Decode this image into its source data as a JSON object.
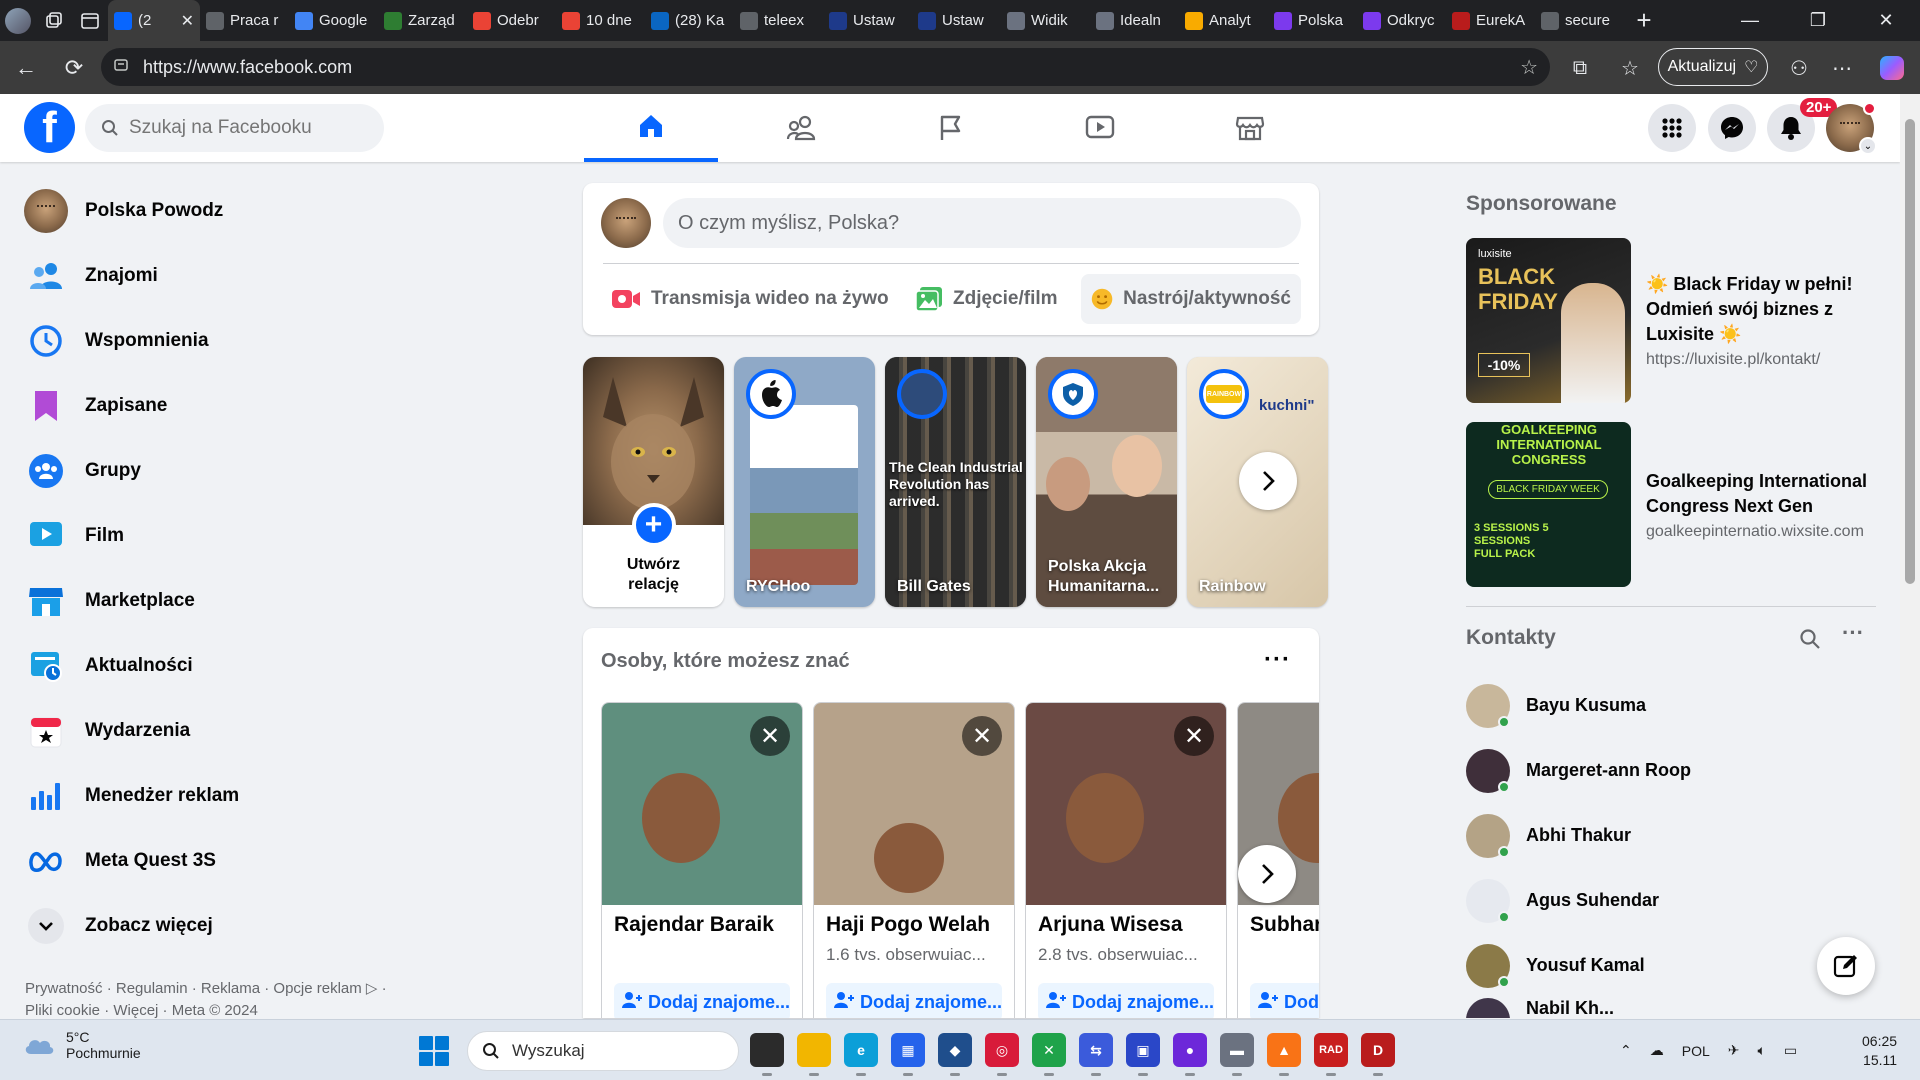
{
  "browser": {
    "tabs": [
      {
        "label": "(2",
        "icon": "facebook-icon",
        "color": "#0866ff",
        "active": true
      },
      {
        "label": "Praca r",
        "icon": "globe-icon",
        "color": "#5f6368"
      },
      {
        "label": "Google",
        "icon": "google-icon",
        "color": "#4285f4"
      },
      {
        "label": "Zarząd",
        "icon": "leaf-icon",
        "color": "#2e7d32"
      },
      {
        "label": "Odebr",
        "icon": "gmail-icon",
        "color": "#ea4335"
      },
      {
        "label": "10 dne",
        "icon": "gmail-icon",
        "color": "#ea4335"
      },
      {
        "label": "(28) Ka",
        "icon": "linkedin-icon",
        "color": "#0a66c2"
      },
      {
        "label": "teleex",
        "icon": "search-icon",
        "color": "#5f6368"
      },
      {
        "label": "Ustaw",
        "icon": "eli-icon",
        "color": "#1e3a8a"
      },
      {
        "label": "Ustaw",
        "icon": "eli-icon",
        "color": "#1e3a8a"
      },
      {
        "label": "Widik",
        "icon": "w-icon",
        "color": "#6b7280"
      },
      {
        "label": "Idealn",
        "icon": "wolf-icon",
        "color": "#6b7280"
      },
      {
        "label": "Analyt",
        "icon": "analytics-icon",
        "color": "#f9ab00"
      },
      {
        "label": "Polska",
        "icon": "butterfly-icon",
        "color": "#7c3aed"
      },
      {
        "label": "Odkryc",
        "icon": "butterfly-icon",
        "color": "#7c3aed"
      },
      {
        "label": "EurekA",
        "icon": "eureka-icon",
        "color": "#b91c1c"
      },
      {
        "label": "secure",
        "icon": "search-icon",
        "color": "#5f6368"
      }
    ],
    "url": "https://www.facebook.com",
    "update_label": "Aktualizuj"
  },
  "header": {
    "search_placeholder": "Szukaj na Facebooku",
    "notification_count": "20+"
  },
  "left_nav": [
    {
      "label": "Polska Powodz",
      "icon": "profile-avatar"
    },
    {
      "label": "Znajomi",
      "icon": "friends-icon"
    },
    {
      "label": "Wspomnienia",
      "icon": "memories-icon"
    },
    {
      "label": "Zapisane",
      "icon": "saved-icon"
    },
    {
      "label": "Grupy",
      "icon": "groups-icon"
    },
    {
      "label": "Film",
      "icon": "video-icon"
    },
    {
      "label": "Marketplace",
      "icon": "marketplace-icon"
    },
    {
      "label": "Aktualności",
      "icon": "feeds-icon"
    },
    {
      "label": "Wydarzenia",
      "icon": "events-icon"
    },
    {
      "label": "Menedżer reklam",
      "icon": "ads-manager-icon"
    },
    {
      "label": "Meta Quest 3S",
      "icon": "meta-icon"
    },
    {
      "label": "Zobacz więcej",
      "icon": "chevron-down-icon"
    }
  ],
  "footer": {
    "line1": "Prywatność · Regulamin · Reklama · Opcje reklam ▷ ·",
    "line2": "Pliki cookie · Więcej · Meta © 2024"
  },
  "composer": {
    "placeholder": "O czym myślisz, Polska?",
    "live_label": "Transmisja wideo na żywo",
    "photo_label": "Zdjęcie/film",
    "feeling_label": "Nastrój/aktywność"
  },
  "stories": {
    "create_line1": "Utwórz",
    "create_line2": "relację",
    "items": [
      {
        "name": "RYCHoo",
        "bg": "#8fa9c7"
      },
      {
        "name": "Bill Gates",
        "bg": "#3b3a38",
        "caption": "The Clean Industrial Revolution has arrived."
      },
      {
        "name": "Polska Akcja Humanitarna...",
        "bg": "#7a6a5c"
      },
      {
        "name": "Rainbow",
        "bg": "#d9cdb8",
        "caption": "kuchni\""
      }
    ]
  },
  "pymk": {
    "title": "Osoby, które możesz znać",
    "people": [
      {
        "name": "Rajendar Baraik",
        "meta": "",
        "add": "Dodaj znajome...",
        "bg": "#5f8f7e"
      },
      {
        "name": "Haji Pogo Welah",
        "meta": "1.6 tvs. obserwuiac...",
        "add": "Dodaj znajome...",
        "bg": "#b6a28a"
      },
      {
        "name": "Arjuna Wisesa",
        "meta": "2.8 tvs. obserwuiac...",
        "add": "Dodaj znajome...",
        "bg": "#6b4a44"
      },
      {
        "name": "Subhar",
        "meta": "",
        "add": "Doda",
        "bg": "#8e8a84"
      }
    ]
  },
  "sponsored": {
    "heading": "Sponsorowane",
    "ads": [
      {
        "title": "☀️ Black Friday w pełni! Odmień swój biznes z Luxisite ☀️",
        "url": "https://luxisite.pl/kontakt/",
        "thumb_heading": "BLACK FRIDAY",
        "thumb_sub": "luxisite",
        "thumb_badge": "-10%"
      },
      {
        "title": "Goalkeeping International Congress Next Gen",
        "url": "goalkeepinternatio.wixsite.com",
        "thumb_heading": "GOALKEEPING INTERNATIONAL CONGRESS",
        "thumb_sub": "BLACK FRIDAY WEEK",
        "thumb_badge": "3 SESSIONS 5 SESSIONS FULL PACK"
      }
    ]
  },
  "contacts": {
    "heading": "Kontakty",
    "items": [
      {
        "name": "Bayu Kusuma",
        "color": "#c8b79b"
      },
      {
        "name": "Margeret-ann Roop",
        "color": "#3f2f3a"
      },
      {
        "name": "Abhi Thakur",
        "color": "#b4a386"
      },
      {
        "name": "Agus Suhendar",
        "color": "#e6e9ef"
      },
      {
        "name": "Yousuf Kamal",
        "color": "#8b7a48"
      },
      {
        "name": "Nabil Kh...",
        "color": "#40364a"
      }
    ]
  },
  "taskbar": {
    "temp": "5°C",
    "weather": "Pochmurnie",
    "search": "Wyszukaj",
    "lang": "POL",
    "time": "06:25",
    "date": "15.11",
    "apps": [
      {
        "icon": "task-view-icon",
        "color": "#2b2b2b",
        "glyph": ""
      },
      {
        "icon": "file-explorer-icon",
        "color": "#f2b600",
        "glyph": ""
      },
      {
        "icon": "edge-icon",
        "color": "#0c9fd8",
        "glyph": "e"
      },
      {
        "icon": "store-icon",
        "color": "#2563eb",
        "glyph": "▦"
      },
      {
        "icon": "virtualbox-icon",
        "color": "#1f4e8c",
        "glyph": "◆"
      },
      {
        "icon": "pdf-app-icon",
        "color": "#d81b3a",
        "glyph": "◎"
      },
      {
        "icon": "xbox-icon",
        "color": "#1fa34a",
        "glyph": "✕"
      },
      {
        "icon": "network-app-icon",
        "color": "#3b5bdb",
        "glyph": "⇆"
      },
      {
        "icon": "save-app-icon",
        "color": "#2a47c8",
        "glyph": "▣"
      },
      {
        "icon": "github-icon",
        "color": "#6d28d9",
        "glyph": "●"
      },
      {
        "icon": "hard-drive-icon",
        "color": "#6b7280",
        "glyph": "▬"
      },
      {
        "icon": "vlc-icon",
        "color": "#f97316",
        "glyph": "▲"
      },
      {
        "icon": "radio-app-icon",
        "color": "#c81e1e",
        "glyph": "RAD"
      },
      {
        "icon": "d-app-icon",
        "color": "#b91c1c",
        "glyph": "D"
      }
    ]
  }
}
